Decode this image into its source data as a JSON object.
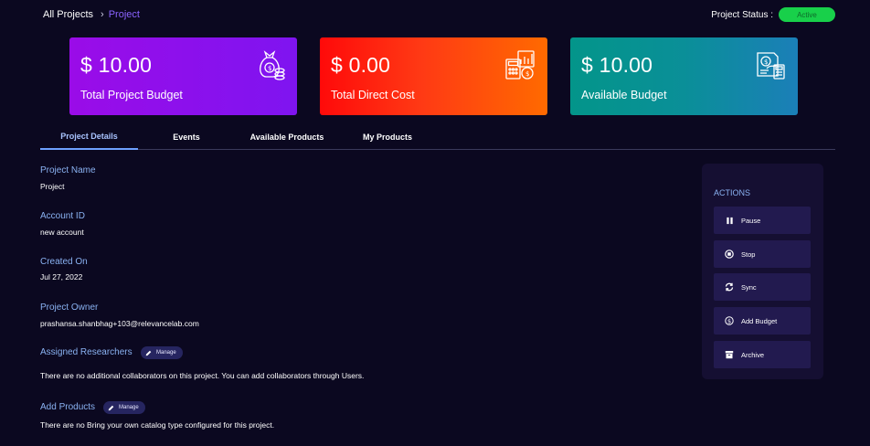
{
  "breadcrumb": {
    "home": "All Projects",
    "separator": "›",
    "current": "Project"
  },
  "status": {
    "label": "Project Status :",
    "value": "Active"
  },
  "cards": [
    {
      "value": "$ 10.00",
      "label": "Total Project Budget",
      "icon": "money-bag-icon"
    },
    {
      "value": "$ 0.00",
      "label": "Total Direct Cost",
      "icon": "calculator-chart-icon"
    },
    {
      "value": "$ 10.00",
      "label": "Available Budget",
      "icon": "budget-report-icon"
    }
  ],
  "tabs": [
    {
      "label": "Project Details",
      "active": true
    },
    {
      "label": "Events"
    },
    {
      "label": "Available Products"
    },
    {
      "label": "My Products"
    }
  ],
  "details": {
    "project_name_label": "Project Name",
    "project_name": "Project",
    "account_id_label": "Account ID",
    "account_id": "new account",
    "created_on_label": "Created On",
    "created_on": "Jul 27, 2022",
    "owner_label": "Project Owner",
    "owner": "prashansa.shanbhag+103@relevancelab.com",
    "researchers_label": "Assigned Researchers",
    "researchers_manage": "Manage",
    "researchers_text": "There are no additional collaborators on this project. You can add collaborators through Users.",
    "products_label": "Add Products",
    "products_manage": "Manage",
    "products_text": "There are no Bring your own catalog type configured for this project."
  },
  "actions": {
    "title": "ACTIONS",
    "items": [
      {
        "label": "Pause",
        "icon": "pause-icon"
      },
      {
        "label": "Stop",
        "icon": "stop-icon"
      },
      {
        "label": "Sync",
        "icon": "sync-icon"
      },
      {
        "label": "Add Budget",
        "icon": "dollar-coin-icon"
      },
      {
        "label": "Archive",
        "icon": "archive-icon"
      }
    ]
  },
  "colors": {
    "background": "#0b0820",
    "accent_label": "#8ab2f2",
    "status_active": "#18d04a",
    "breadcrumb_current": "#8b63ff"
  }
}
